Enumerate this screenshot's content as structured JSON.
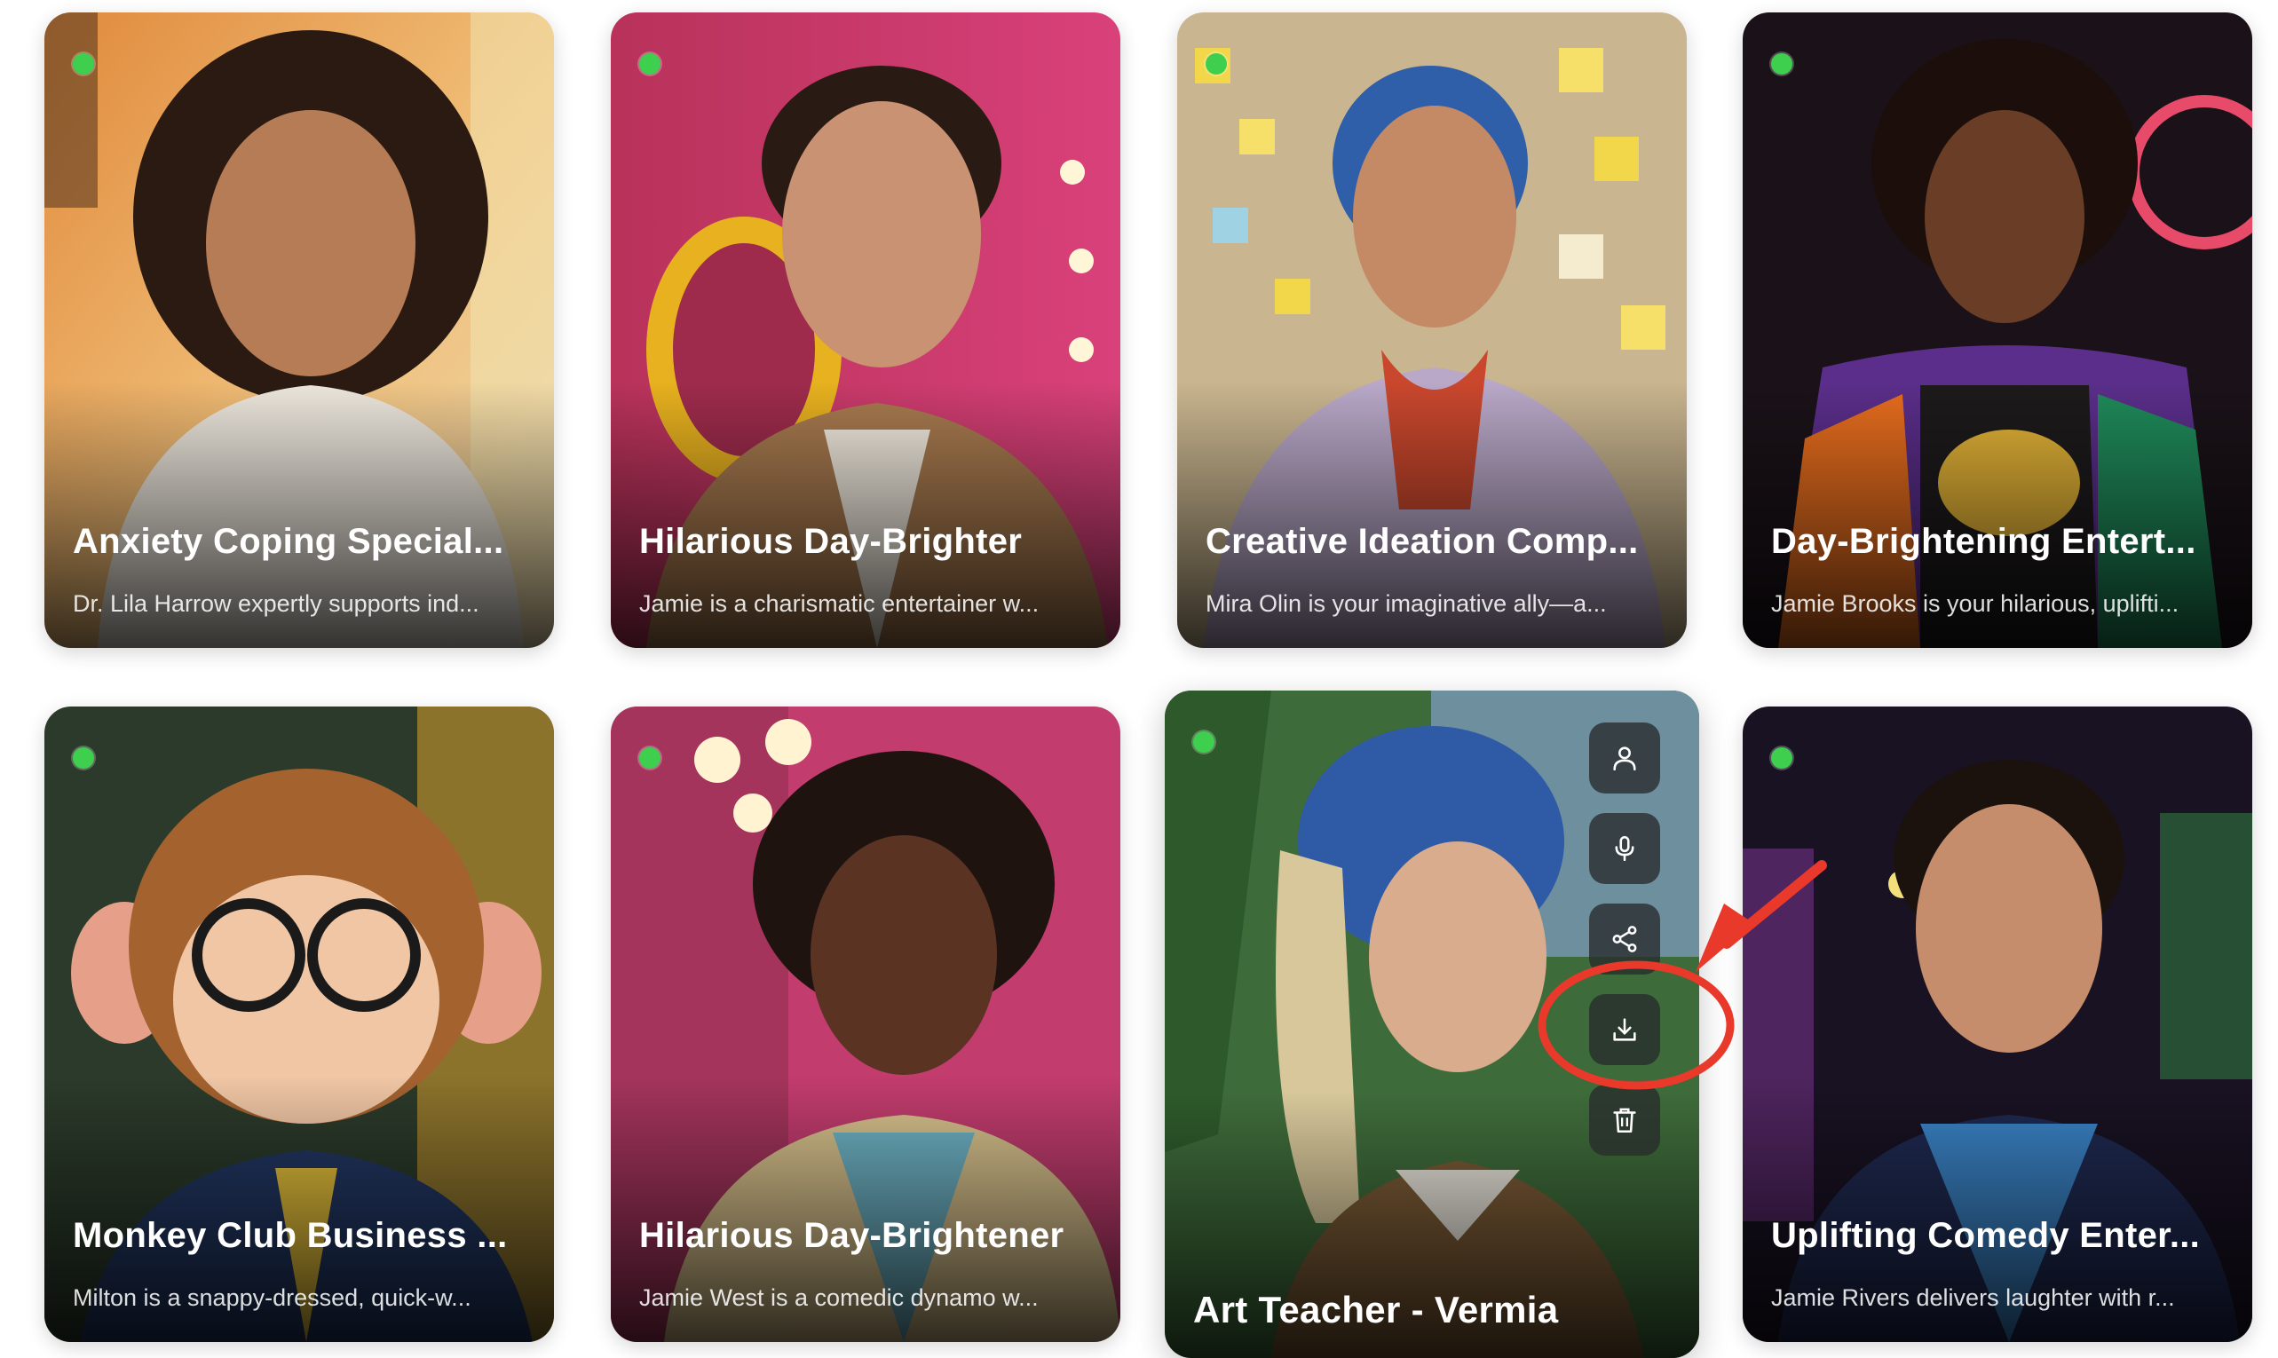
{
  "cards": [
    {
      "title": "Anxiety Coping Special...",
      "description": "Dr. Lila Harrow expertly supports ind...",
      "online": true
    },
    {
      "title": "Hilarious Day-Brighter",
      "description": "Jamie is a charismatic entertainer w...",
      "online": true
    },
    {
      "title": "Creative Ideation Comp...",
      "description": "Mira Olin is your imaginative ally—a...",
      "online": true
    },
    {
      "title": "Day-Brightening Entert...",
      "description": "Jamie Brooks is your hilarious, uplifti...",
      "online": true
    },
    {
      "title": "Monkey Club Business ...",
      "description": "Milton is a snappy-dressed, quick-w...",
      "online": true
    },
    {
      "title": "Hilarious Day-Brightener",
      "description": "Jamie West is a comedic dynamo w...",
      "online": true
    },
    {
      "title": "Art Teacher - Vermia",
      "description": "",
      "online": true
    },
    {
      "title": "Uplifting Comedy Enter...",
      "description": "Jamie Rivers delivers laughter with r...",
      "online": true
    }
  ],
  "hover_actions": [
    {
      "icon": "user-icon"
    },
    {
      "icon": "microphone-icon"
    },
    {
      "icon": "share-icon"
    },
    {
      "icon": "download-icon"
    },
    {
      "icon": "trash-icon"
    }
  ],
  "colors": {
    "online": "#3ecf4f",
    "annotation": "#e8392b"
  }
}
